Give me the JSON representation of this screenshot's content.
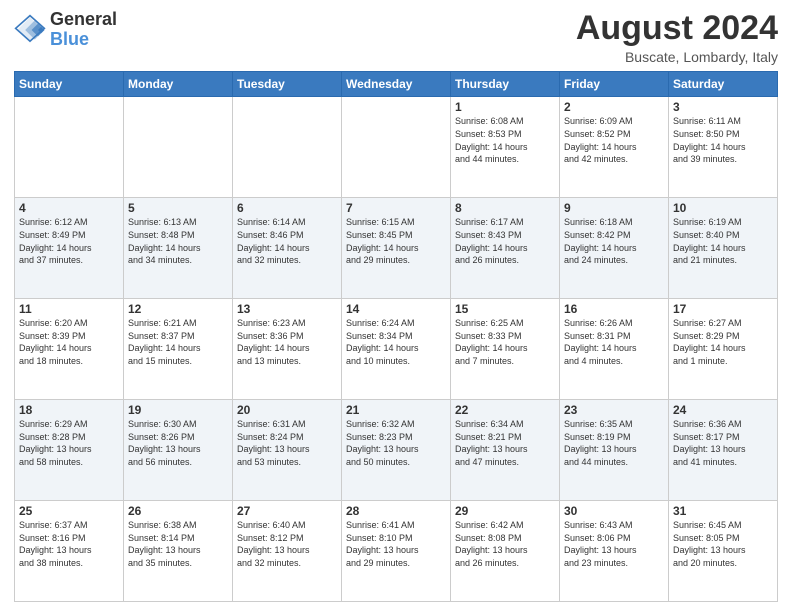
{
  "logo": {
    "line1": "General",
    "line2": "Blue"
  },
  "header": {
    "title": "August 2024",
    "subtitle": "Buscate, Lombardy, Italy"
  },
  "days_of_week": [
    "Sunday",
    "Monday",
    "Tuesday",
    "Wednesday",
    "Thursday",
    "Friday",
    "Saturday"
  ],
  "weeks": [
    [
      {
        "day": "",
        "info": ""
      },
      {
        "day": "",
        "info": ""
      },
      {
        "day": "",
        "info": ""
      },
      {
        "day": "",
        "info": ""
      },
      {
        "day": "1",
        "info": "Sunrise: 6:08 AM\nSunset: 8:53 PM\nDaylight: 14 hours\nand 44 minutes."
      },
      {
        "day": "2",
        "info": "Sunrise: 6:09 AM\nSunset: 8:52 PM\nDaylight: 14 hours\nand 42 minutes."
      },
      {
        "day": "3",
        "info": "Sunrise: 6:11 AM\nSunset: 8:50 PM\nDaylight: 14 hours\nand 39 minutes."
      }
    ],
    [
      {
        "day": "4",
        "info": "Sunrise: 6:12 AM\nSunset: 8:49 PM\nDaylight: 14 hours\nand 37 minutes."
      },
      {
        "day": "5",
        "info": "Sunrise: 6:13 AM\nSunset: 8:48 PM\nDaylight: 14 hours\nand 34 minutes."
      },
      {
        "day": "6",
        "info": "Sunrise: 6:14 AM\nSunset: 8:46 PM\nDaylight: 14 hours\nand 32 minutes."
      },
      {
        "day": "7",
        "info": "Sunrise: 6:15 AM\nSunset: 8:45 PM\nDaylight: 14 hours\nand 29 minutes."
      },
      {
        "day": "8",
        "info": "Sunrise: 6:17 AM\nSunset: 8:43 PM\nDaylight: 14 hours\nand 26 minutes."
      },
      {
        "day": "9",
        "info": "Sunrise: 6:18 AM\nSunset: 8:42 PM\nDaylight: 14 hours\nand 24 minutes."
      },
      {
        "day": "10",
        "info": "Sunrise: 6:19 AM\nSunset: 8:40 PM\nDaylight: 14 hours\nand 21 minutes."
      }
    ],
    [
      {
        "day": "11",
        "info": "Sunrise: 6:20 AM\nSunset: 8:39 PM\nDaylight: 14 hours\nand 18 minutes."
      },
      {
        "day": "12",
        "info": "Sunrise: 6:21 AM\nSunset: 8:37 PM\nDaylight: 14 hours\nand 15 minutes."
      },
      {
        "day": "13",
        "info": "Sunrise: 6:23 AM\nSunset: 8:36 PM\nDaylight: 14 hours\nand 13 minutes."
      },
      {
        "day": "14",
        "info": "Sunrise: 6:24 AM\nSunset: 8:34 PM\nDaylight: 14 hours\nand 10 minutes."
      },
      {
        "day": "15",
        "info": "Sunrise: 6:25 AM\nSunset: 8:33 PM\nDaylight: 14 hours\nand 7 minutes."
      },
      {
        "day": "16",
        "info": "Sunrise: 6:26 AM\nSunset: 8:31 PM\nDaylight: 14 hours\nand 4 minutes."
      },
      {
        "day": "17",
        "info": "Sunrise: 6:27 AM\nSunset: 8:29 PM\nDaylight: 14 hours\nand 1 minute."
      }
    ],
    [
      {
        "day": "18",
        "info": "Sunrise: 6:29 AM\nSunset: 8:28 PM\nDaylight: 13 hours\nand 58 minutes."
      },
      {
        "day": "19",
        "info": "Sunrise: 6:30 AM\nSunset: 8:26 PM\nDaylight: 13 hours\nand 56 minutes."
      },
      {
        "day": "20",
        "info": "Sunrise: 6:31 AM\nSunset: 8:24 PM\nDaylight: 13 hours\nand 53 minutes."
      },
      {
        "day": "21",
        "info": "Sunrise: 6:32 AM\nSunset: 8:23 PM\nDaylight: 13 hours\nand 50 minutes."
      },
      {
        "day": "22",
        "info": "Sunrise: 6:34 AM\nSunset: 8:21 PM\nDaylight: 13 hours\nand 47 minutes."
      },
      {
        "day": "23",
        "info": "Sunrise: 6:35 AM\nSunset: 8:19 PM\nDaylight: 13 hours\nand 44 minutes."
      },
      {
        "day": "24",
        "info": "Sunrise: 6:36 AM\nSunset: 8:17 PM\nDaylight: 13 hours\nand 41 minutes."
      }
    ],
    [
      {
        "day": "25",
        "info": "Sunrise: 6:37 AM\nSunset: 8:16 PM\nDaylight: 13 hours\nand 38 minutes."
      },
      {
        "day": "26",
        "info": "Sunrise: 6:38 AM\nSunset: 8:14 PM\nDaylight: 13 hours\nand 35 minutes."
      },
      {
        "day": "27",
        "info": "Sunrise: 6:40 AM\nSunset: 8:12 PM\nDaylight: 13 hours\nand 32 minutes."
      },
      {
        "day": "28",
        "info": "Sunrise: 6:41 AM\nSunset: 8:10 PM\nDaylight: 13 hours\nand 29 minutes."
      },
      {
        "day": "29",
        "info": "Sunrise: 6:42 AM\nSunset: 8:08 PM\nDaylight: 13 hours\nand 26 minutes."
      },
      {
        "day": "30",
        "info": "Sunrise: 6:43 AM\nSunset: 8:06 PM\nDaylight: 13 hours\nand 23 minutes."
      },
      {
        "day": "31",
        "info": "Sunrise: 6:45 AM\nSunset: 8:05 PM\nDaylight: 13 hours\nand 20 minutes."
      }
    ]
  ]
}
